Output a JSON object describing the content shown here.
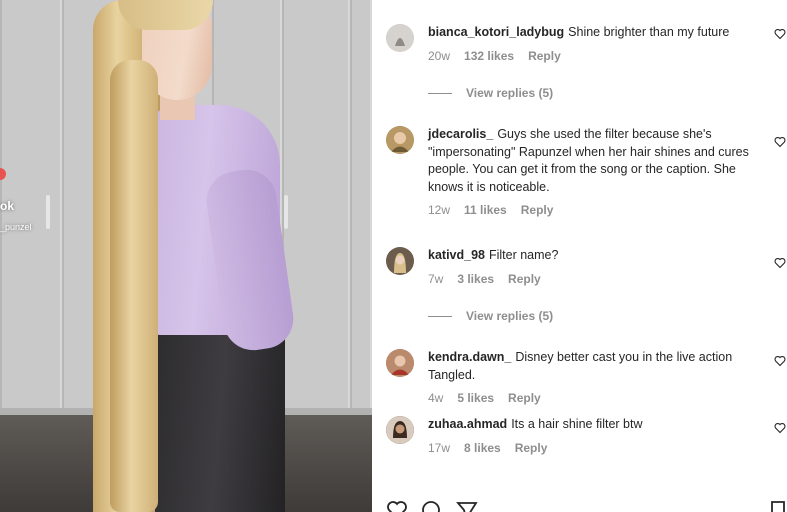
{
  "media": {
    "overlay_title": "ok",
    "overlay_caption": "_punzel"
  },
  "comments": [
    {
      "username": "bianca_kotori_ladybug",
      "text": "Shine brighter than my future",
      "age": "20w",
      "likes": "132 likes",
      "reply": "Reply",
      "avatar_color": "#c9c6c2"
    },
    {
      "username": "jdecarolis_",
      "text": "Guys she used the filter because she's \"impersonating\" Rapunzel when her hair shines and cures people. You can get it from the song or the caption. She knows it is noticeable.",
      "age": "12w",
      "likes": "11 likes",
      "reply": "Reply",
      "avatar_color": "#a58a55"
    },
    {
      "username": "kativd_98",
      "text": "Filter name?",
      "age": "7w",
      "likes": "3 likes",
      "reply": "Reply",
      "avatar_color": "#8e7f71"
    },
    {
      "username": "kendra.dawn_",
      "text": "Disney better cast you in the live action Tangled.",
      "age": "4w",
      "likes": "5 likes",
      "reply": "Reply",
      "avatar_color": "#b76d5c"
    },
    {
      "username": "zuhaa.ahmad",
      "text": "Its a hair shine filter btw",
      "age": "17w",
      "likes": "8 likes",
      "reply": "Reply",
      "avatar_color": "#6d5443"
    }
  ],
  "view_replies": [
    {
      "label": "View replies (5)"
    },
    {
      "label": "View replies (5)"
    }
  ],
  "icons": {
    "like": "heart-icon",
    "comment": "comment-icon",
    "share": "paper-plane-icon",
    "save": "bookmark-icon"
  }
}
